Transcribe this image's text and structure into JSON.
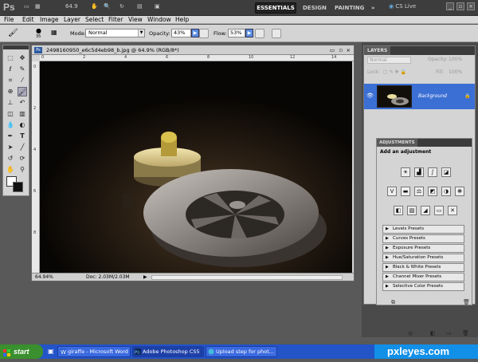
{
  "app": {
    "logo": "Ps",
    "zoom": "64.9"
  },
  "workspaces": {
    "essentials": "ESSENTIALS",
    "design": "DESIGN",
    "painting": "PAINTING",
    "more": "»",
    "cs_live": "CS Live"
  },
  "menu": [
    "File",
    "Edit",
    "Image",
    "Layer",
    "Select",
    "Filter",
    "View",
    "Window",
    "Help"
  ],
  "options": {
    "brush_size": "35",
    "mode_label": "Mode:",
    "mode_value": "Normal",
    "opacity_label": "Opacity:",
    "opacity_value": "43%",
    "flow_label": "Flow:",
    "flow_value": "53%"
  },
  "document": {
    "title": "2498160950_e6c5d4eb98_b.jpg @ 64.9% (RGB/8*)",
    "zoom": "64.94%",
    "doc_info": "Doc: 2.03M/2.03M",
    "ruler_top": [
      "0",
      "2",
      "4",
      "6",
      "8",
      "10",
      "12",
      "14"
    ],
    "ruler_left": [
      "0",
      "2",
      "4",
      "6",
      "8"
    ]
  },
  "layers": {
    "tab": "LAYERS",
    "blend": "Normal",
    "opacity_label": "Opacity:",
    "opacity_value": "100%",
    "lock_label": "Lock:",
    "fill_label": "Fill:",
    "fill_value": "100%",
    "layer_name": "Background"
  },
  "adjustments": {
    "tab": "ADJUSTMENTS",
    "heading": "Add an adjustment",
    "presets": [
      "Levels Presets",
      "Curves Presets",
      "Exposure Presets",
      "Hue/Saturation Presets",
      "Black & White Presets",
      "Channel Mixer Presets",
      "Selective Color Presets"
    ]
  },
  "taskbar": {
    "start": "start",
    "items": [
      "giraffe - Microsoft Word",
      "Adobe Photoshop CS5",
      "Upload step for phot..."
    ],
    "watermark": "pxleyes.com"
  },
  "colors": {
    "accent": "#3b6fd4",
    "taskbar": "#2354c8",
    "start": "#3a8f2e"
  }
}
